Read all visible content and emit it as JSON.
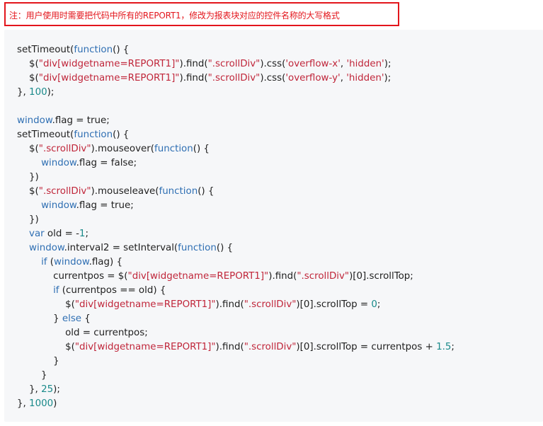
{
  "note": {
    "text": "注：用户使用时需要把代码中所有的REPORT1，修改为报表块对应的控件名称的大写格式"
  },
  "code": {
    "lines": [
      [
        [
          "p",
          "setTimeout("
        ],
        [
          "k",
          "function"
        ],
        [
          "p",
          "() {"
        ]
      ],
      [
        [
          "p",
          "    $("
        ],
        [
          "s",
          "\"div[widgetname=REPORT1]\""
        ],
        [
          "p",
          ").find("
        ],
        [
          "s",
          "\".scrollDiv\""
        ],
        [
          "p",
          ").css("
        ],
        [
          "s",
          "'overflow-x'"
        ],
        [
          "p",
          ", "
        ],
        [
          "s",
          "'hidden'"
        ],
        [
          "p",
          ");"
        ]
      ],
      [
        [
          "p",
          "    $("
        ],
        [
          "s",
          "\"div[widgetname=REPORT1]\""
        ],
        [
          "p",
          ").find("
        ],
        [
          "s",
          "\".scrollDiv\""
        ],
        [
          "p",
          ").css("
        ],
        [
          "s",
          "'overflow-y'"
        ],
        [
          "p",
          ", "
        ],
        [
          "s",
          "'hidden'"
        ],
        [
          "p",
          ");"
        ]
      ],
      [
        [
          "p",
          "}, "
        ],
        [
          "n",
          "100"
        ],
        [
          "p",
          ");"
        ]
      ],
      [],
      [
        [
          "k",
          "window"
        ],
        [
          "p",
          ".flag = true;"
        ]
      ],
      [
        [
          "p",
          "setTimeout("
        ],
        [
          "k",
          "function"
        ],
        [
          "p",
          "() {"
        ]
      ],
      [
        [
          "p",
          "    $("
        ],
        [
          "s",
          "\".scrollDiv\""
        ],
        [
          "p",
          ").mouseover("
        ],
        [
          "k",
          "function"
        ],
        [
          "p",
          "() {"
        ]
      ],
      [
        [
          "p",
          "        "
        ],
        [
          "k",
          "window"
        ],
        [
          "p",
          ".flag = false;"
        ]
      ],
      [
        [
          "p",
          "    })"
        ]
      ],
      [
        [
          "p",
          "    $("
        ],
        [
          "s",
          "\".scrollDiv\""
        ],
        [
          "p",
          ").mouseleave("
        ],
        [
          "k",
          "function"
        ],
        [
          "p",
          "() {"
        ]
      ],
      [
        [
          "p",
          "        "
        ],
        [
          "k",
          "window"
        ],
        [
          "p",
          ".flag = true;"
        ]
      ],
      [
        [
          "p",
          "    })"
        ]
      ],
      [
        [
          "p",
          "    "
        ],
        [
          "k",
          "var"
        ],
        [
          "p",
          " old = -"
        ],
        [
          "n",
          "1"
        ],
        [
          "p",
          ";"
        ]
      ],
      [
        [
          "p",
          "    "
        ],
        [
          "k",
          "window"
        ],
        [
          "p",
          ".interval2 = setInterval("
        ],
        [
          "k",
          "function"
        ],
        [
          "p",
          "() {"
        ]
      ],
      [
        [
          "p",
          "        "
        ],
        [
          "k",
          "if"
        ],
        [
          "p",
          " ("
        ],
        [
          "k",
          "window"
        ],
        [
          "p",
          ".flag) {"
        ]
      ],
      [
        [
          "p",
          "            currentpos = $("
        ],
        [
          "s",
          "\"div[widgetname=REPORT1]\""
        ],
        [
          "p",
          ").find("
        ],
        [
          "s",
          "\".scrollDiv\""
        ],
        [
          "p",
          ")[0].scrollTop;"
        ]
      ],
      [
        [
          "p",
          "            "
        ],
        [
          "k",
          "if"
        ],
        [
          "p",
          " (currentpos == old) {"
        ]
      ],
      [
        [
          "p",
          "                $("
        ],
        [
          "s",
          "\"div[widgetname=REPORT1]\""
        ],
        [
          "p",
          ").find("
        ],
        [
          "s",
          "\".scrollDiv\""
        ],
        [
          "p",
          ")[0].scrollTop = "
        ],
        [
          "n",
          "0"
        ],
        [
          "p",
          ";"
        ]
      ],
      [
        [
          "p",
          "            } "
        ],
        [
          "k",
          "else"
        ],
        [
          "p",
          " {"
        ]
      ],
      [
        [
          "p",
          "                old = currentpos;"
        ]
      ],
      [
        [
          "p",
          "                $("
        ],
        [
          "s",
          "\"div[widgetname=REPORT1]\""
        ],
        [
          "p",
          ").find("
        ],
        [
          "s",
          "\".scrollDiv\""
        ],
        [
          "p",
          ")[0].scrollTop = currentpos + "
        ],
        [
          "n",
          "1.5"
        ],
        [
          "p",
          ";"
        ]
      ],
      [
        [
          "p",
          "            }"
        ]
      ],
      [
        [
          "p",
          "        }"
        ]
      ],
      [
        [
          "p",
          "    }, "
        ],
        [
          "n",
          "25"
        ],
        [
          "p",
          ");"
        ]
      ],
      [
        [
          "p",
          "}, "
        ],
        [
          "n",
          "1000"
        ],
        [
          "p",
          ")"
        ]
      ]
    ]
  },
  "colors": {
    "note_red": "#e3161c",
    "keyword_blue": "#2f6fb3",
    "string_red": "#c0263a",
    "number_teal": "#1a8a8a",
    "panel_bg": "#f6f7f9"
  }
}
